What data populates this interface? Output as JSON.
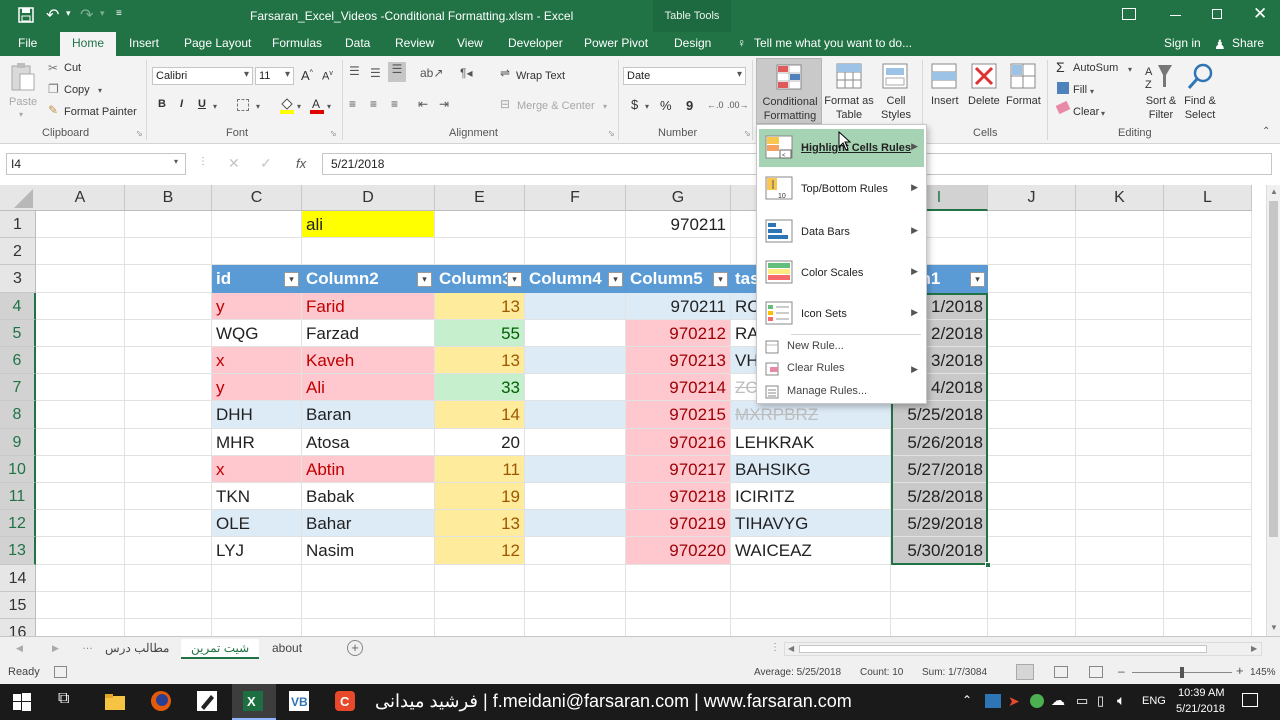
{
  "titlebar": {
    "filename": "Farsaran_Excel_Videos -Conditional Formatting.xlsm - Excel",
    "context_tab": "Table Tools"
  },
  "ribbon_tabs": [
    "File",
    "Home",
    "Insert",
    "Page Layout",
    "Formulas",
    "Data",
    "Review",
    "View",
    "Developer",
    "Power Pivot",
    "Design"
  ],
  "active_tab": "Home",
  "tell_me": "Tell me what you want to do...",
  "sign_in": "Sign in",
  "share": "Share",
  "clipboard": {
    "paste": "Paste",
    "cut": "Cut",
    "copy": "Copy",
    "format_painter": "Format Painter",
    "label": "Clipboard"
  },
  "font": {
    "name": "Calibri",
    "size": "11",
    "bold": "B",
    "italic": "I",
    "underline": "U",
    "label": "Font"
  },
  "alignment": {
    "wrap_text": "Wrap Text",
    "merge_center": "Merge & Center",
    "label": "Alignment"
  },
  "number": {
    "format": "Date",
    "currency": "$",
    "percent": "%",
    "comma": "9",
    "label": "Number"
  },
  "styles": {
    "conditional_formatting": "Conditional Formatting",
    "format_as_table": "Format as Table",
    "cell_styles": "Cell Styles"
  },
  "cells": {
    "insert": "Insert",
    "delete": "Delete",
    "format": "Format",
    "label": "Cells"
  },
  "editing": {
    "autosum": "AutoSum",
    "fill": "Fill",
    "clear": "Clear",
    "sort_filter": "Sort & Filter",
    "find_select": "Find & Select",
    "label": "Editing"
  },
  "formula_bar": {
    "name_box": "I4",
    "fx": "fx",
    "value": "5/21/2018"
  },
  "columns": [
    "A",
    "B",
    "C",
    "D",
    "E",
    "F",
    "G",
    "H",
    "I",
    "J",
    "K",
    "L"
  ],
  "rows": [
    "1",
    "2",
    "3",
    "4",
    "5",
    "6",
    "7",
    "8",
    "9",
    "10",
    "11",
    "12",
    "13",
    "14",
    "15",
    "16"
  ],
  "sheet": {
    "d1": "ali",
    "g1": "970211",
    "headers": [
      "id",
      "Column2",
      "Column3",
      "Column4",
      "Column5",
      "tas",
      "umn1"
    ],
    "table_rows": [
      {
        "id": "y",
        "c2": "Farid",
        "c3": "13",
        "c5": "970211",
        "tas": "RC",
        "date": "1/2018"
      },
      {
        "id": "WQG",
        "c2": "Farzad",
        "c3": "55",
        "c5": "970212",
        "tas": "RA",
        "date": "2/2018"
      },
      {
        "id": "x",
        "c2": "Kaveh",
        "c3": "13",
        "c5": "970213",
        "tas": "VH",
        "date": "3/2018"
      },
      {
        "id": "y",
        "c2": "Ali",
        "c3": "33",
        "c5": "970214",
        "tas": "ZC",
        "date": "4/2018"
      },
      {
        "id": "DHH",
        "c2": "Baran",
        "c3": "14",
        "c5": "970215",
        "tas": "MXRPBRZ",
        "date": "5/25/2018"
      },
      {
        "id": "MHR",
        "c2": "Atosa",
        "c3": "20",
        "c5": "970216",
        "tas": "LEHKRAK",
        "date": "5/26/2018"
      },
      {
        "id": "x",
        "c2": "Abtin",
        "c3": "11",
        "c5": "970217",
        "tas": "BAHSIKG",
        "date": "5/27/2018"
      },
      {
        "id": "TKN",
        "c2": "Babak",
        "c3": "19",
        "c5": "970218",
        "tas": "ICIRITZ",
        "date": "5/28/2018"
      },
      {
        "id": "OLE",
        "c2": "Bahar",
        "c3": "13",
        "c5": "970219",
        "tas": "TIHAVYG",
        "date": "5/29/2018"
      },
      {
        "id": "LYJ",
        "c2": "Nasim",
        "c3": "12",
        "c5": "970220",
        "tas": "WAICEAZ",
        "date": "5/30/2018"
      }
    ]
  },
  "cf_menu": {
    "items": [
      "Highlight Cells Rules",
      "Top/Bottom Rules",
      "Data Bars",
      "Color Scales",
      "Icon Sets"
    ],
    "small": [
      "New Rule...",
      "Clear Rules",
      "Manage Rules..."
    ]
  },
  "sheet_tabs": [
    "مطالب درس",
    "شیت تمرین",
    "about"
  ],
  "status": {
    "ready": "Ready",
    "average": "Average: 5/25/2018",
    "count": "Count: 10",
    "sum": "Sum: 1/7/3084",
    "zoom": "145%"
  },
  "taskbar": {
    "banner": "فرشید میدانی  |  f.meidani@farsaran.com  |  www.farsaran.com",
    "lang": "ENG",
    "time": "10:39 AM",
    "date": "5/21/2018"
  },
  "colors": {
    "excel_green": "#217346",
    "table_header": "#5b9bd5",
    "band": "#ddebf7",
    "red_fill": "#ffc7ce",
    "yellow_fill": "#ffeb9c",
    "green_fill": "#c6efce"
  }
}
